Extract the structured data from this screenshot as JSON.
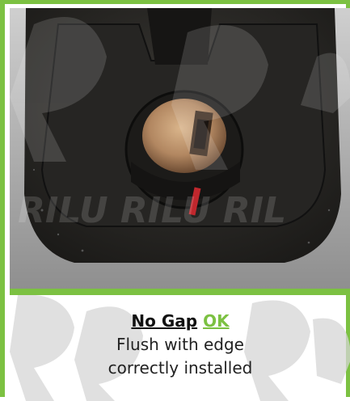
{
  "caption": {
    "title_prefix": "No Gap",
    "title_status": "OK",
    "line1": "Flush with edge",
    "line2": "correctly installed"
  },
  "colors": {
    "frame": "#7cc142",
    "status_ok": "#7cc142"
  },
  "icons": {
    "watermark": "rr-logo-watermark",
    "lock": "lock-cylinder-icon"
  }
}
